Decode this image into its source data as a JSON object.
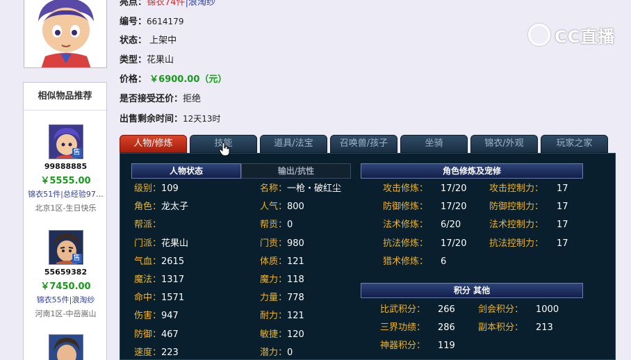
{
  "item": {
    "highlight_label": "亮点：",
    "highlight_value_a": "锦衣74件",
    "highlight_value_b": "|浪淘纱",
    "id_label": "编号：",
    "id_value": "6614179",
    "status_label": "状态：",
    "status_value": "上架中",
    "type_label": "类型：",
    "type_value": "花果山",
    "price_label": "价格：",
    "price_value": "￥6900.00（元）",
    "counter_label": "是否接受还价：",
    "counter_value": "拒绝",
    "remain_label": "出售剩余时间：",
    "remain_value": "12天13时"
  },
  "watermark": {
    "text": "CC直播"
  },
  "recommend": {
    "title": "相似物品推荐",
    "sell_tag": "售",
    "items": [
      {
        "id": "99888885",
        "price": "￥5555.00",
        "desc": "锦衣51件|总经验97…",
        "server": "北京1区-生日快乐"
      },
      {
        "id": "55659382",
        "price": "￥7450.00",
        "desc": "锦衣55件|浪淘纱",
        "server": "河南1区-中岳嵩山"
      }
    ]
  },
  "tabs": [
    "人物/修炼",
    "技能",
    "道具/法宝",
    "召唤兽/孩子",
    "坐骑",
    "锦衣/外观",
    "玩家之家"
  ],
  "panel": {
    "char_status_title": "人物状态",
    "output_title": "输出/抗性",
    "cultivation_title": "角色修炼及宠修",
    "points_title": "积分  其他",
    "left_stats": [
      {
        "label": "级别：",
        "value": "109"
      },
      {
        "label": "角色：",
        "value": "龙太子"
      },
      {
        "label": "帮派：",
        "value": ""
      },
      {
        "label": "门派：",
        "value": "花果山"
      },
      {
        "label": "气血：",
        "value": "2615"
      },
      {
        "label": "魔法：",
        "value": "1317"
      },
      {
        "label": "命中：",
        "value": "1571"
      },
      {
        "label": "伤害：",
        "value": "947"
      },
      {
        "label": "防御：",
        "value": "467"
      },
      {
        "label": "速度：",
        "value": "223"
      }
    ],
    "mid_stats": [
      {
        "label": "名称：",
        "value": "一枪・破红尘"
      },
      {
        "label": "人气：",
        "value": "800"
      },
      {
        "label": "帮贡：",
        "value": "0"
      },
      {
        "label": "门贡：",
        "value": "980"
      },
      {
        "label": "体质：",
        "value": "121"
      },
      {
        "label": "魔力：",
        "value": "118"
      },
      {
        "label": "力量：",
        "value": "778"
      },
      {
        "label": "耐力：",
        "value": "121"
      },
      {
        "label": "敏捷：",
        "value": "120"
      },
      {
        "label": "潜力：",
        "value": "0"
      }
    ],
    "cult_left": [
      {
        "label": "攻击修炼：",
        "value": "17/20"
      },
      {
        "label": "防御修炼：",
        "value": "17/20"
      },
      {
        "label": "法术修炼：",
        "value": "6/20"
      },
      {
        "label": "抗法修炼：",
        "value": "17/20"
      },
      {
        "label": "猎术修炼：",
        "value": "6"
      }
    ],
    "cult_right": [
      {
        "label": "攻击控制力：",
        "value": "17"
      },
      {
        "label": "防御控制力：",
        "value": "17"
      },
      {
        "label": "法术控制力：",
        "value": "17"
      },
      {
        "label": "抗法控制力：",
        "value": "17"
      }
    ],
    "points_left": [
      {
        "label": "比武积分：",
        "value": "266"
      },
      {
        "label": "三界功绩：",
        "value": "286"
      },
      {
        "label": "神器积分：",
        "value": "119"
      }
    ],
    "points_right": [
      {
        "label": "剑会积分：",
        "value": "1000"
      },
      {
        "label": "副本积分：",
        "value": "213"
      }
    ]
  }
}
